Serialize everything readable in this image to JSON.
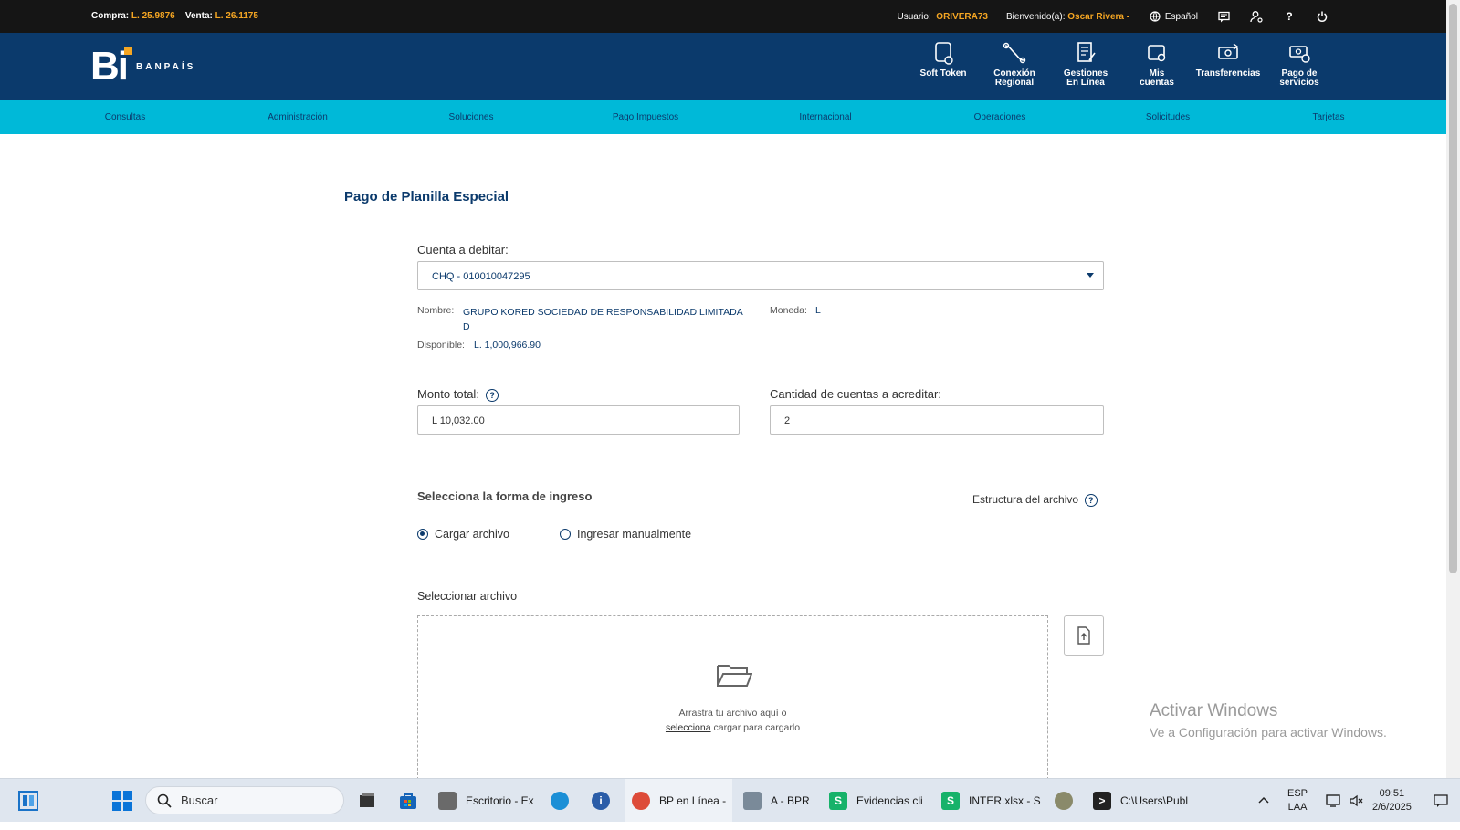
{
  "topbar": {
    "compra_label": "Compra:",
    "compra_value": "L. 25.9876",
    "venta_label": "Venta:",
    "venta_value": "L. 26.1175",
    "usuario_label": "Usuario:",
    "usuario_value": "ORIVERA73",
    "bienvenido_label": "Bienvenido(a):",
    "bienvenido_value": "Oscar Rivera -",
    "language": "Español",
    "help": "?"
  },
  "brand": {
    "logo_text": "Bi",
    "name": "BANPAÍS"
  },
  "quick_links": [
    {
      "line1": "Soft Token",
      "line2": ""
    },
    {
      "line1": "Conexión",
      "line2": "Regional"
    },
    {
      "line1": "Gestiones",
      "line2": "En Línea"
    },
    {
      "line1": "Mis",
      "line2": "cuentas"
    },
    {
      "line1": "Transferencias",
      "line2": ""
    },
    {
      "line1": "Pago de",
      "line2": "servicios"
    }
  ],
  "menu": [
    "Consultas",
    "Administración",
    "Soluciones",
    "Pago Impuestos",
    "Internacional",
    "Operaciones",
    "Solicitudes",
    "Tarjetas"
  ],
  "page": {
    "title": "Pago de Planilla Especial",
    "cuenta_label": "Cuenta a debitar:",
    "cuenta_value": "CHQ - 010010047295",
    "nombre_label": "Nombre:",
    "nombre_line1": "GRUPO KORED SOCIEDAD DE RESPONSABILIDAD LIMITADA",
    "nombre_line2": "D",
    "moneda_label": "Moneda:",
    "moneda_value": "L",
    "disponible_label": "Disponible:",
    "disponible_value": "L. 1,000,966.90",
    "monto_label": "Monto total:",
    "monto_value": "L 10,032.00",
    "cantidad_label": "Cantidad de cuentas a acreditar:",
    "cantidad_value": "2",
    "section_title": "Selecciona la forma de ingreso",
    "estructura_link": "Estructura del archivo",
    "radio_cargar": "Cargar archivo",
    "radio_manual": "Ingresar manualmente",
    "seleccionar_label": "Seleccionar archivo",
    "drop_line1": "Arrastra tu archivo aquí o",
    "drop_link": "selecciona",
    "drop_line2_rest": " cargar para cargarlo",
    "help_glyph": "?"
  },
  "watermark": {
    "line1": "Activar Windows",
    "line2": "Ve a Configuración para activar Windows."
  },
  "taskbar": {
    "search_placeholder": "Buscar",
    "apps": [
      "Escritorio - Ex",
      "BP en Línea -",
      "A - BPR",
      "Evidencias cli",
      "INTER.xlsx - S",
      "C:\\Users\\Publ"
    ],
    "lang1": "ESP",
    "lang2": "LAA",
    "time": "09:51",
    "date": "2/6/2025"
  },
  "colors": {
    "navy": "#0b3a6c",
    "cyan": "#00b9d8",
    "orange": "#f5a623"
  }
}
